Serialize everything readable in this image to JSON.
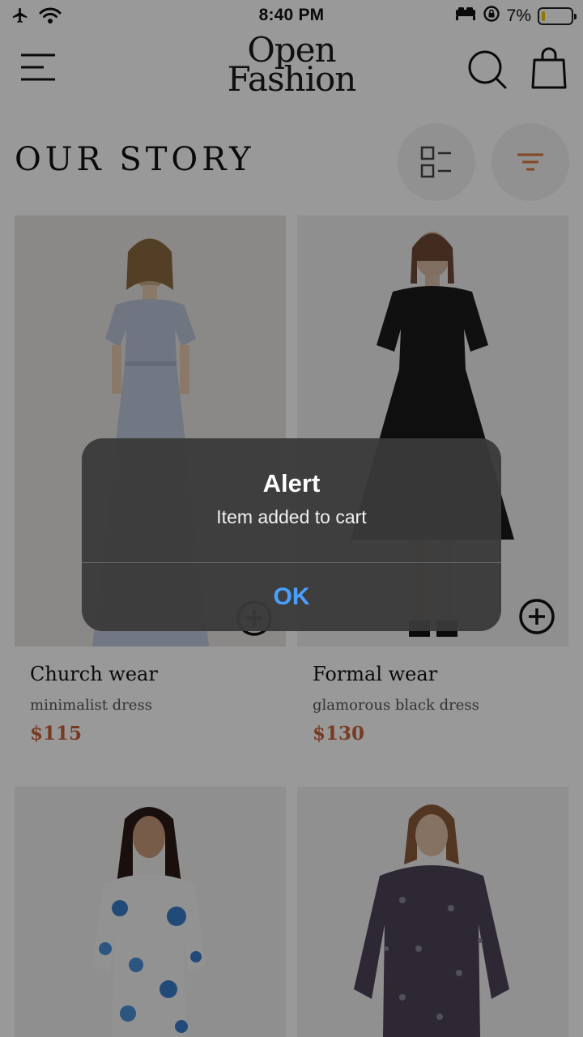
{
  "status_bar": {
    "time": "8:40 PM",
    "battery_percent": "7%",
    "icons": [
      "airplane-icon",
      "wifi-icon",
      "bed-icon",
      "orientation-lock-icon",
      "battery-icon"
    ]
  },
  "header": {
    "logo_line1": "Open",
    "logo_line2": "Fashion",
    "icons": [
      "menu-icon",
      "search-icon",
      "shopping-bag-icon"
    ]
  },
  "page": {
    "title": "OUR STORY",
    "view_toggle_icon": "list-view-icon",
    "filter_icon": "filter-icon"
  },
  "products": [
    {
      "name": "Church wear",
      "description": "minimalist dress",
      "price": "$115"
    },
    {
      "name": "Formal wear",
      "description": "glamorous black dress",
      "price": "$130"
    },
    {
      "name": "",
      "description": "",
      "price": ""
    },
    {
      "name": "",
      "description": "",
      "price": ""
    }
  ],
  "alert": {
    "title": "Alert",
    "message": "Item added to cart",
    "ok_label": "OK"
  },
  "colors": {
    "accent_price": "#c8623a",
    "filter_icon": "#d9773f",
    "alert_button": "#4aa0ff",
    "overlay": "rgba(0,0,0,0.40)"
  }
}
